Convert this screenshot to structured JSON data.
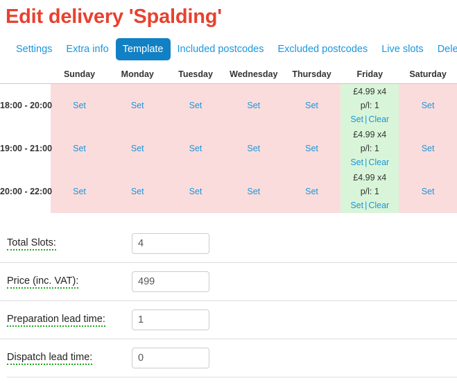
{
  "page": {
    "title": "Edit delivery 'Spalding'"
  },
  "tabs": [
    {
      "label": "Settings",
      "active": false
    },
    {
      "label": "Extra info",
      "active": false
    },
    {
      "label": "Template",
      "active": true
    },
    {
      "label": "Included postcodes",
      "active": false
    },
    {
      "label": "Excluded postcodes",
      "active": false
    },
    {
      "label": "Live slots",
      "active": false
    },
    {
      "label": "Delete",
      "active": false
    }
  ],
  "schedule": {
    "time_column_header": "",
    "day_headers": [
      "Sunday",
      "Monday",
      "Tuesday",
      "Wednesday",
      "Thursday",
      "Friday",
      "Saturday"
    ],
    "set_link_label": "Set",
    "clear_link_label": "Clear",
    "separator": "|",
    "rows": [
      {
        "time": "18:00 - 20:00",
        "cells": [
          {
            "state": "empty",
            "action": "Set"
          },
          {
            "state": "empty",
            "action": "Set"
          },
          {
            "state": "empty",
            "action": "Set"
          },
          {
            "state": "empty",
            "action": "Set"
          },
          {
            "state": "empty",
            "action": "Set"
          },
          {
            "state": "set",
            "price": "£4.99 x4",
            "per_line": "p/l: 1",
            "action": "Set",
            "clear": "Clear"
          },
          {
            "state": "empty",
            "action": "Set"
          }
        ]
      },
      {
        "time": "19:00 - 21:00",
        "cells": [
          {
            "state": "empty",
            "action": "Set"
          },
          {
            "state": "empty",
            "action": "Set"
          },
          {
            "state": "empty",
            "action": "Set"
          },
          {
            "state": "empty",
            "action": "Set"
          },
          {
            "state": "empty",
            "action": "Set"
          },
          {
            "state": "set",
            "price": "£4.99 x4",
            "per_line": "p/l: 1",
            "action": "Set",
            "clear": "Clear"
          },
          {
            "state": "empty",
            "action": "Set"
          }
        ]
      },
      {
        "time": "20:00 - 22:00",
        "cells": [
          {
            "state": "empty",
            "action": "Set"
          },
          {
            "state": "empty",
            "action": "Set"
          },
          {
            "state": "empty",
            "action": "Set"
          },
          {
            "state": "empty",
            "action": "Set"
          },
          {
            "state": "empty",
            "action": "Set"
          },
          {
            "state": "set",
            "price": "£4.99 x4",
            "per_line": "p/l: 1",
            "action": "Set",
            "clear": "Clear"
          },
          {
            "state": "empty",
            "action": "Set"
          }
        ]
      }
    ]
  },
  "form": {
    "fields": [
      {
        "label": "Total Slots:",
        "value": "4",
        "name": "total-slots"
      },
      {
        "label": "Price (inc. VAT):",
        "value": "499",
        "name": "price-inc-vat"
      },
      {
        "label": "Preparation lead time:",
        "value": "1",
        "name": "preparation-lead-time"
      },
      {
        "label": "Dispatch lead time:",
        "value": "0",
        "name": "dispatch-lead-time"
      }
    ]
  },
  "colors": {
    "title_red": "#e8412f",
    "link_blue": "#1a96dd",
    "active_tab_blue": "#1180c4",
    "slot_empty_pink": "#fbdcdc",
    "slot_set_green": "#d9f5d9",
    "label_underline_green": "#1aaa1a"
  }
}
